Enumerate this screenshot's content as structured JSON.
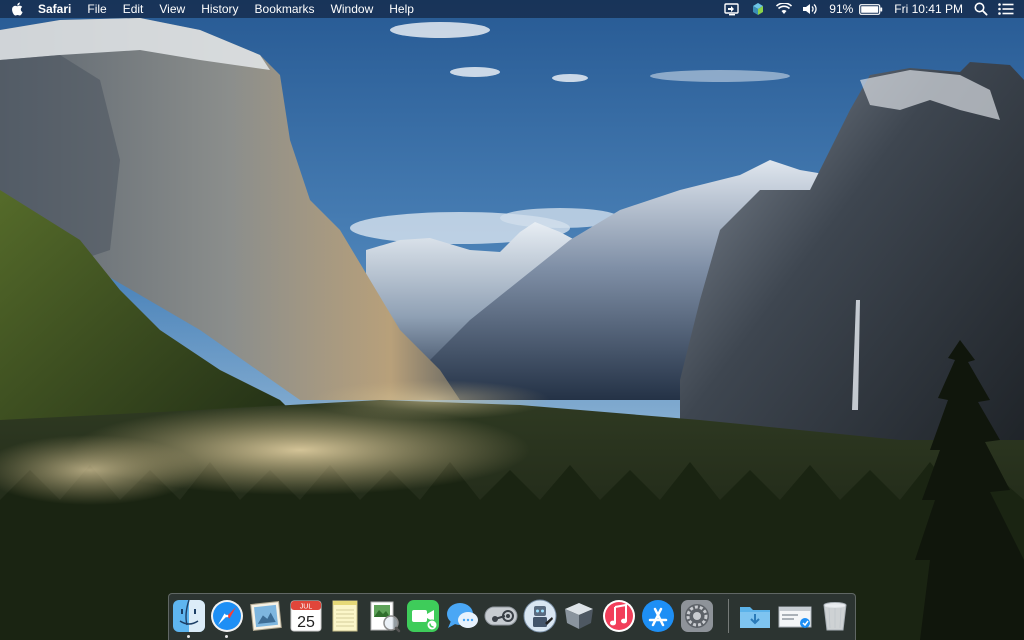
{
  "menubar": {
    "app_name": "Safari",
    "menus": [
      "File",
      "Edit",
      "View",
      "History",
      "Bookmarks",
      "Window",
      "Help"
    ],
    "battery_percent": "91%",
    "clock": "Fri 10:41 PM",
    "status_icons": [
      "screen-share-icon",
      "cloud-sync-icon",
      "wifi-icon",
      "volume-icon",
      "battery-icon",
      "spotlight-icon",
      "notification-center-icon"
    ]
  },
  "dock": {
    "apps": [
      {
        "name": "Finder",
        "icon": "finder-icon",
        "running": true
      },
      {
        "name": "Safari",
        "icon": "safari-icon",
        "running": true
      },
      {
        "name": "Mail",
        "icon": "mail-icon",
        "running": false
      },
      {
        "name": "Calendar",
        "icon": "calendar-icon",
        "running": false,
        "month": "JUL",
        "day": "25"
      },
      {
        "name": "Notes",
        "icon": "notes-icon",
        "running": false
      },
      {
        "name": "Preview",
        "icon": "preview-icon",
        "running": false
      },
      {
        "name": "FaceTime",
        "icon": "facetime-icon",
        "running": false
      },
      {
        "name": "Messages",
        "icon": "messages-icon",
        "running": false
      },
      {
        "name": "Steam",
        "icon": "steam-icon",
        "running": false
      },
      {
        "name": "Automator",
        "icon": "automator-icon",
        "running": false
      },
      {
        "name": "Wunderbucket",
        "icon": "wunderbucket-icon",
        "running": false
      },
      {
        "name": "iTunes",
        "icon": "itunes-icon",
        "running": false
      },
      {
        "name": "App Store",
        "icon": "app-store-icon",
        "running": false
      },
      {
        "name": "System Preferences",
        "icon": "system-preferences-icon",
        "running": false
      },
      {
        "name": "Downloads",
        "icon": "folder-icon",
        "running": false
      },
      {
        "name": "Preview Stack",
        "icon": "preview-stack-icon",
        "running": false
      },
      {
        "name": "Trash",
        "icon": "trash-icon",
        "running": false
      }
    ]
  },
  "colors": {
    "menubar_bg": "#142642",
    "sky_top": "#2a5c96",
    "sky_bottom": "#a8c6de",
    "rock": "#7a7d80",
    "forest": "#2c3a1c"
  }
}
